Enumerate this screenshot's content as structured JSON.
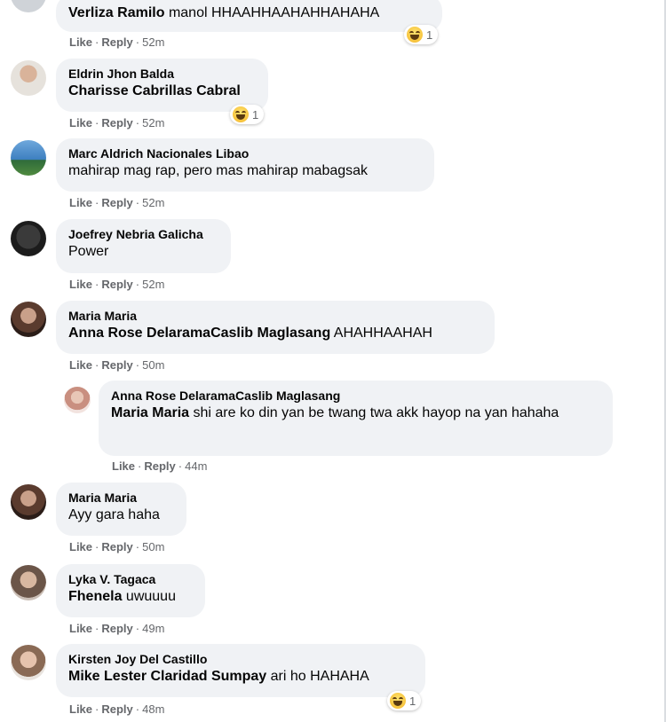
{
  "comments": [
    {
      "author": "Verliza Ramilo",
      "mention": "",
      "text": "manol HHAAHHAAHAHHAHAHA",
      "time": "52m",
      "reaction_count": "1"
    },
    {
      "author": "Eldrin Jhon Balda",
      "mention": "Charisse Cabrillas Cabral",
      "text": "",
      "time": "52m",
      "reaction_count": "1"
    },
    {
      "author": "Marc Aldrich Nacionales Libao",
      "mention": "",
      "text": "mahirap mag rap, pero mas mahirap mabagsak",
      "time": "52m"
    },
    {
      "author": "Joefrey Nebria Galicha",
      "mention": "",
      "text": "Power",
      "time": "52m"
    },
    {
      "author": "Maria Maria",
      "mention": "Anna Rose DelaramaCaslib Maglasang",
      "text": " AHAHHAAHAH",
      "time": "50m"
    },
    {
      "author": "Anna Rose DelaramaCaslib Maglasang",
      "mention": "Maria Maria",
      "text": " shi are ko din yan be twang twa akk hayop na yan hahaha",
      "time": "44m"
    },
    {
      "author": "Maria Maria",
      "mention": "",
      "text": "Ayy gara haha",
      "time": "50m"
    },
    {
      "author": "Lyka V. Tagaca",
      "mention": "Fhenela",
      "text": " uwuuuu",
      "time": "49m"
    },
    {
      "author": "Kirsten Joy Del Castillo",
      "mention": "Mike Lester Claridad Sumpay",
      "text": " ari ho HAHAHA",
      "time": "48m",
      "reaction_count": "1"
    }
  ],
  "labels": {
    "like": "Like",
    "reply": "Reply",
    "separator": "·"
  },
  "reaction_icon": "haha-emoji-icon",
  "colors": {
    "bubble": "#f0f2f5",
    "meta": "#65676b",
    "text": "#050505"
  }
}
